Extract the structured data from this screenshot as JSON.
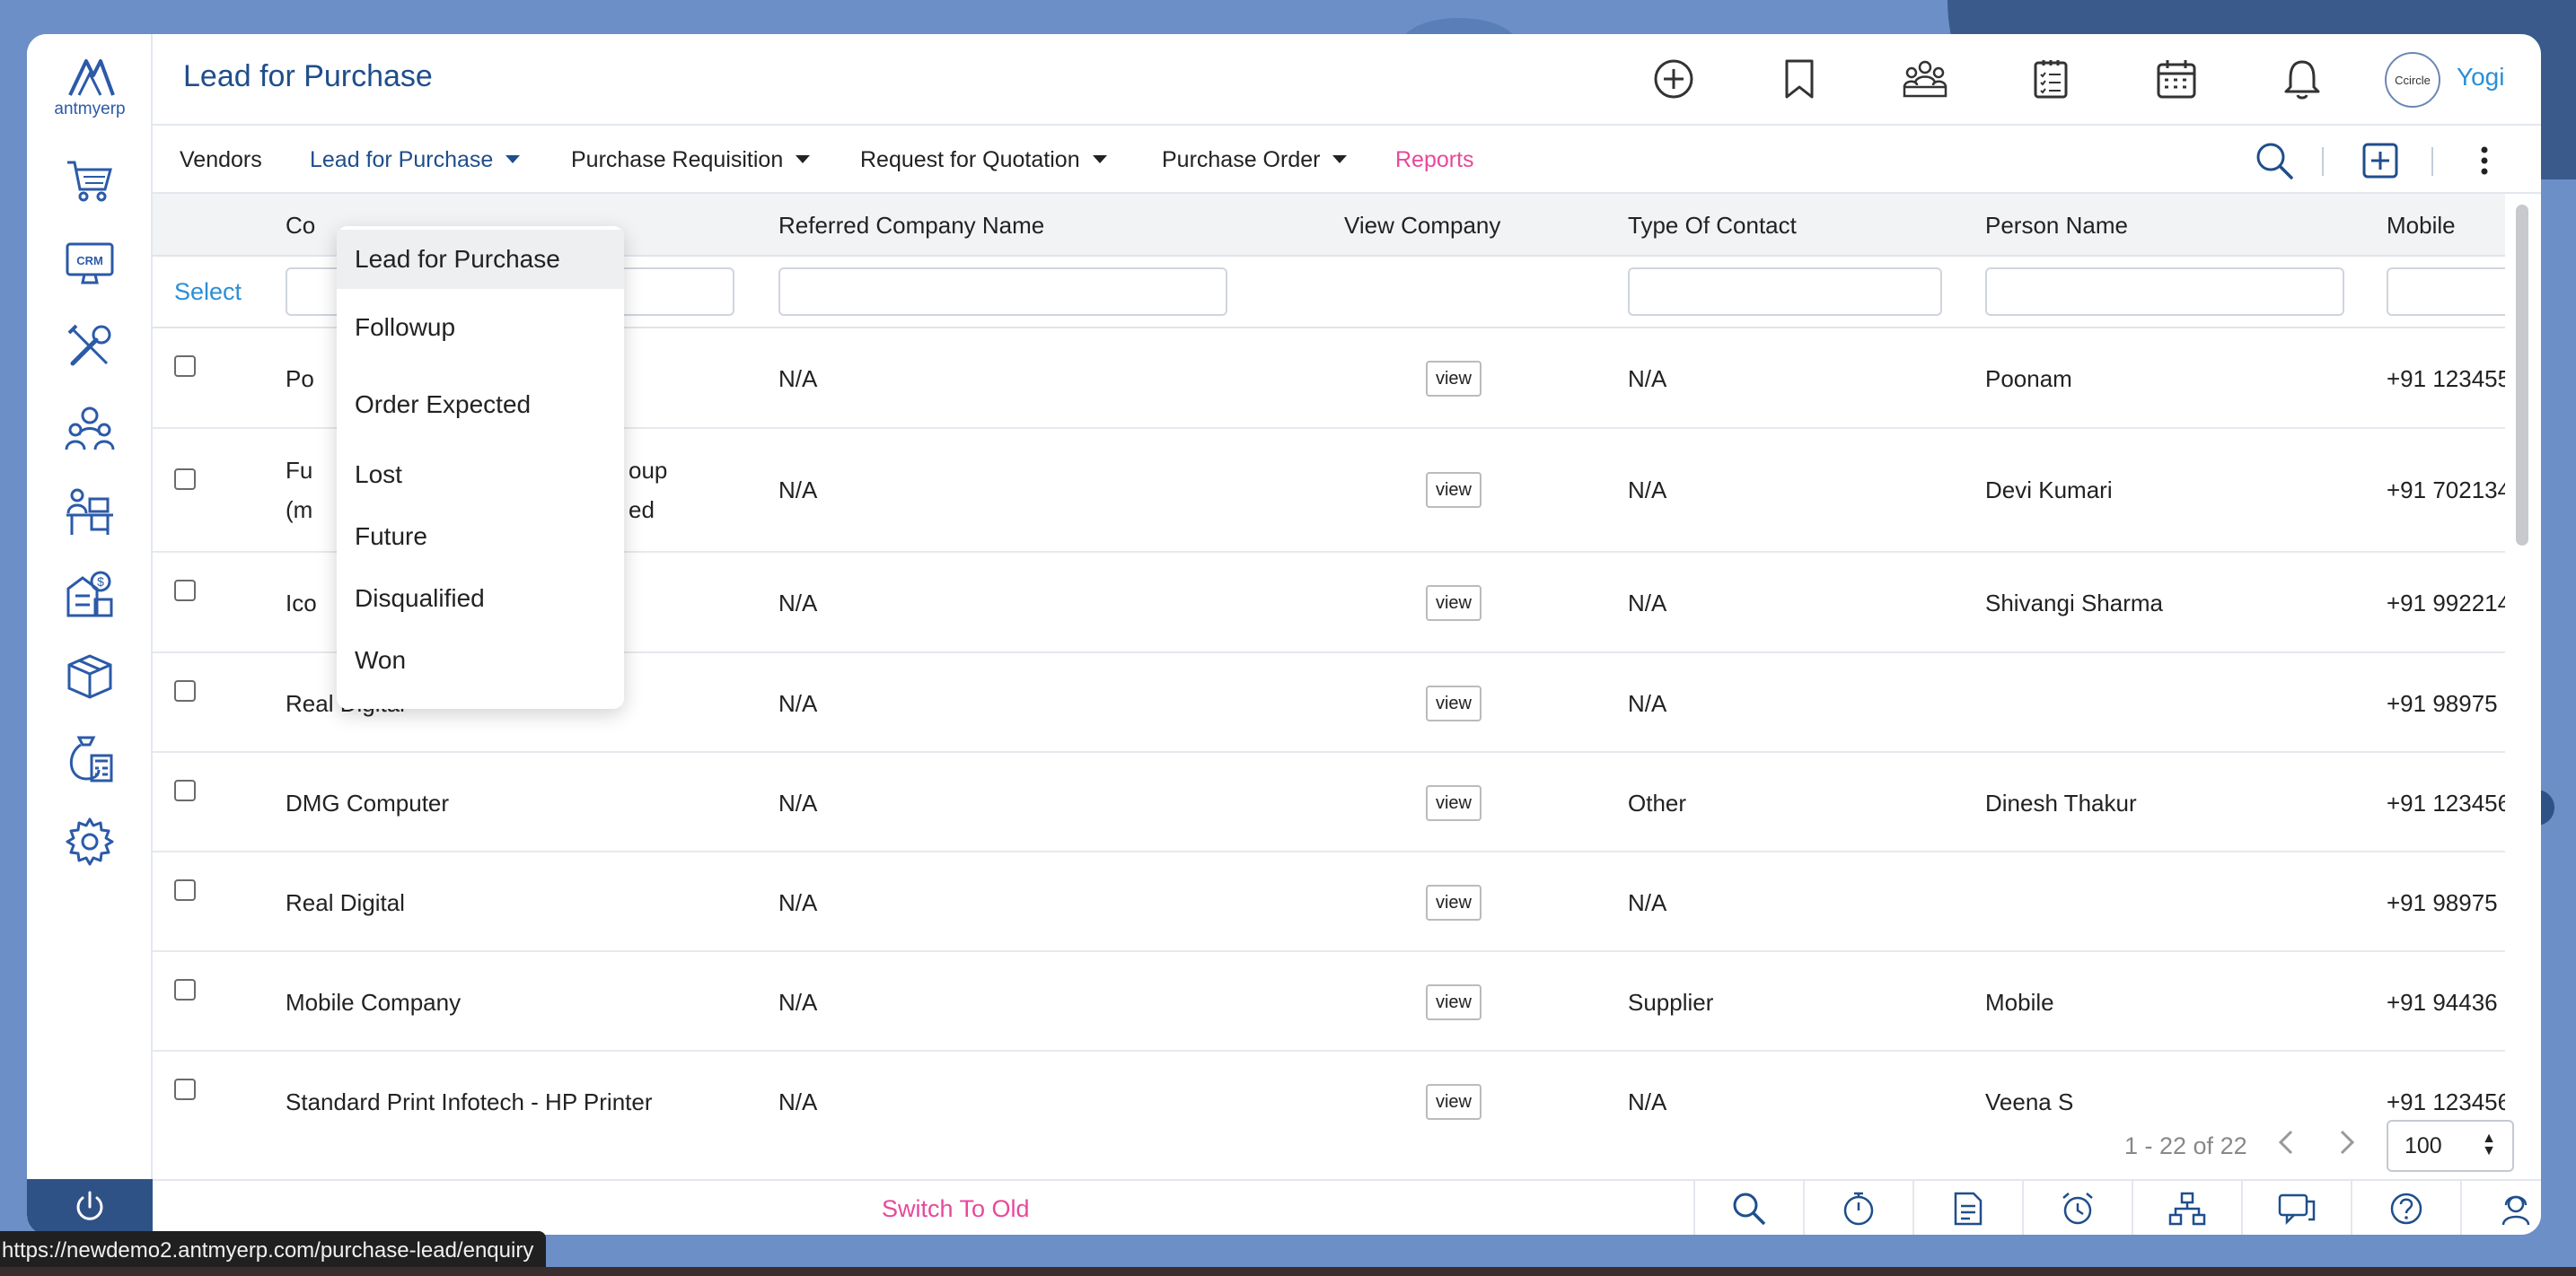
{
  "app": {
    "logo_text": "antmyerp",
    "page_title": "Lead for Purchase",
    "user_name": "Yogi",
    "avatar_text": "Ccircle"
  },
  "sidebar": {
    "items": [
      {
        "icon": "shopping-cart-icon"
      },
      {
        "icon": "crm-monitor-icon",
        "label": "CRM"
      },
      {
        "icon": "tools-icon"
      },
      {
        "icon": "team-icon"
      },
      {
        "icon": "office-desk-icon"
      },
      {
        "icon": "finance-building-icon"
      },
      {
        "icon": "box-icon"
      },
      {
        "icon": "money-bag-icon"
      },
      {
        "icon": "gear-icon"
      }
    ]
  },
  "header_icons": [
    "add-circle-icon",
    "bookmark-icon",
    "meeting-icon",
    "checklist-icon",
    "calendar-icon",
    "bell-icon"
  ],
  "nav": {
    "vendors": "Vendors",
    "lead_for_purchase": "Lead for Purchase",
    "purchase_requisition": "Purchase Requisition",
    "request_for_quotation": "Request for Quotation",
    "purchase_order": "Purchase Order",
    "reports": "Reports"
  },
  "table": {
    "columns": {
      "company": "Co",
      "referred_company": "Referred Company Name",
      "view_company": "View Company",
      "type_of_contact": "Type Of Contact",
      "person_name": "Person Name",
      "mobile": "Mobile"
    },
    "select_label": "Select",
    "view_label": "view",
    "rows": [
      {
        "company": "Po",
        "company2": "",
        "referred": "N/A",
        "type": "N/A",
        "person": "Poonam",
        "mobile": "+91 123455"
      },
      {
        "company": "Fu",
        "company_suffix": "oup",
        "company2": "(m",
        "company2_suffix": "ed",
        "referred": "N/A",
        "type": "N/A",
        "person": "Devi Kumari",
        "mobile": "+91 702134"
      },
      {
        "company": "Ico",
        "company2": "",
        "referred": "N/A",
        "type": "N/A",
        "person": "Shivangi Sharma",
        "mobile": "+91 992214"
      },
      {
        "company": "Real Digital",
        "company2": "",
        "referred": "N/A",
        "type": "N/A",
        "person": "",
        "mobile": "+91 98975"
      },
      {
        "company": "DMG Computer",
        "company2": "",
        "referred": "N/A",
        "type": "Other",
        "person": "Dinesh Thakur",
        "mobile": "+91 123456"
      },
      {
        "company": "Real Digital",
        "company2": "",
        "referred": "N/A",
        "type": "N/A",
        "person": "",
        "mobile": "+91 98975"
      },
      {
        "company": "Mobile Company",
        "company2": "",
        "referred": "N/A",
        "type": "Supplier",
        "person": "Mobile",
        "mobile": "+91 94436"
      },
      {
        "company": "Standard Print Infotech - HP Printer",
        "company2": "",
        "referred": "N/A",
        "type": "N/A",
        "person": "Veena S",
        "mobile": "+91 123456"
      }
    ]
  },
  "dropdown": {
    "items": [
      "Lead for Purchase",
      "Followup",
      "Order Expected",
      "Lost",
      "Future",
      "Disqualified",
      "Won"
    ],
    "selected": "Lead for Purchase"
  },
  "pagination": {
    "range_text": "1 - 22 of 22",
    "page_size": "100"
  },
  "footer": {
    "switch_label": "Switch To Old",
    "icons": [
      "search-icon",
      "timer-icon",
      "document-icon",
      "alarm-icon",
      "org-chart-icon",
      "chat-icon",
      "help-icon",
      "support-agent-icon"
    ]
  },
  "status_bar": {
    "url": "https://newdemo2.antmyerp.com/purchase-lead/enquiry"
  },
  "colors": {
    "brand_blue": "#1f4e8c",
    "link_blue": "#2b8fd6",
    "accent_pink": "#e8489a",
    "sidebar_power_bg": "#2f5286"
  }
}
